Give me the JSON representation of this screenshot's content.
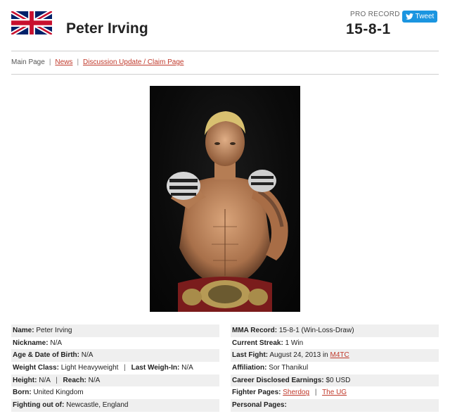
{
  "header": {
    "flag_icon": "uk-flag-icon",
    "fighter_name": "Peter Irving",
    "record_label": "PRO RECORD",
    "record_value": "15-8-1",
    "tweet_label": "Tweet"
  },
  "nav": {
    "main_page": "Main Page",
    "separator": "|",
    "news": "News",
    "discussion": "Discussion Update / Claim Page"
  },
  "photo": {
    "description_icon": "fighter-photo"
  },
  "left_info": [
    {
      "label": "Name:",
      "value": "Peter Irving"
    },
    {
      "label": "Nickname:",
      "value": "N/A"
    },
    {
      "label": "Age & Date of Birth:",
      "value": "N/A"
    },
    {
      "label": "Weight Class:",
      "value": "Light Heavyweight",
      "label2": "Last Weigh-In:",
      "value2": "N/A"
    },
    {
      "label": "Height:",
      "value": "N/A",
      "label2": "Reach:",
      "value2": "N/A"
    },
    {
      "label": "Born:",
      "value": "United Kingdom"
    },
    {
      "label": "Fighting out of:",
      "value": "Newcastle, England"
    }
  ],
  "right_info": {
    "mma_record_label": "MMA Record:",
    "mma_record_value": "15-8-1 (Win-Loss-Draw)",
    "streak_label": "Current Streak:",
    "streak_value": "1 Win",
    "last_fight_label": "Last Fight:",
    "last_fight_value": "August 24, 2013 in",
    "last_fight_event": "M4TC",
    "affiliation_label": "Affiliation:",
    "affiliation_value": "Sor Thanikul",
    "earnings_label": "Career Disclosed Earnings:",
    "earnings_value": "$0 USD",
    "fighter_pages_label": "Fighter Pages:",
    "fighter_pages_link1": "Sherdog",
    "fighter_pages_sep": "|",
    "fighter_pages_link2": "The UG",
    "personal_pages_label": "Personal Pages:"
  },
  "colors": {
    "link": "#c0392b",
    "tweet": "#1b95e0",
    "row_shade": "#efefef"
  }
}
